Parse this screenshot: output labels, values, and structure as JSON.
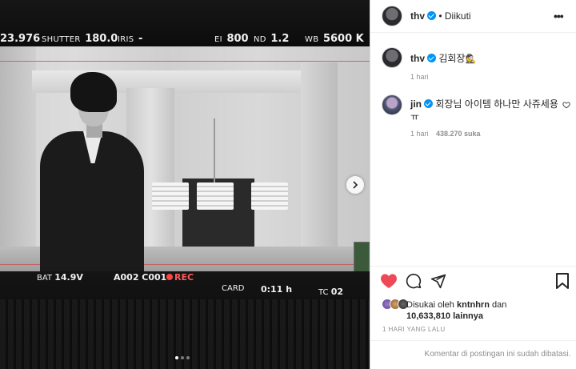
{
  "camera": {
    "fps": "23.976",
    "shutter_label": "SHUTTER",
    "shutter_value": "180.0",
    "iris_label": "IRIS",
    "iris_value": "-",
    "ei_label": "EI",
    "ei_value": "800",
    "nd_label": "ND",
    "nd_value": "1.2",
    "wb_label": "WB",
    "wb_value": "5600 K",
    "bat_label": "BAT",
    "bat_value": "14.9V",
    "clip": "A002 C001",
    "rec_label": "REC",
    "card_label": "CARD",
    "time": "0:11 h",
    "tc_label": "TC",
    "tc_value": "02"
  },
  "carousel": {
    "total": 3,
    "active": 0
  },
  "post": {
    "username": "thv",
    "separator": "•",
    "follow_status": "Diikuti",
    "caption_user": "thv",
    "caption_text": "김회장",
    "caption_emoji": "🕵",
    "caption_time": "1 hari"
  },
  "comments": [
    {
      "user": "jin",
      "text": "회장님 아이템 하나만 사쥬세용ㅠ",
      "time": "1 hari",
      "likes": "438.270 suka"
    }
  ],
  "likes": {
    "prefix": "Disukai oleh",
    "user": "kntnhrn",
    "conj": "dan",
    "count": "10,633,810 lainnya"
  },
  "date": "1 HARI YANG LALU",
  "comments_closed": "Komentar di postingan ini sudah dibatasi.",
  "colors": {
    "verified": "#0095f6",
    "liked": "#ed4956",
    "rec": "#ff4444"
  }
}
